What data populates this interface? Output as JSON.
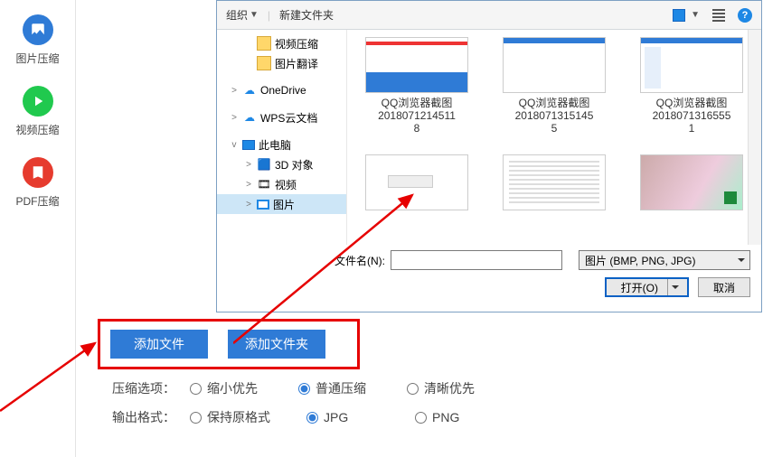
{
  "sidebar": {
    "items": [
      {
        "label": "图片压缩",
        "bg": "#2f7bd6"
      },
      {
        "label": "视频压缩",
        "bg": "#20c94e"
      },
      {
        "label": "PDF压缩",
        "bg": "#e63b2e"
      }
    ]
  },
  "dialog": {
    "toolbar": {
      "organize": "组织",
      "new_folder": "新建文件夹",
      "help_glyph": "?"
    },
    "tree": {
      "items": [
        {
          "depth": 2,
          "icon": "folder",
          "label": "视频压缩"
        },
        {
          "depth": 2,
          "icon": "folder",
          "label": "图片翻译"
        },
        {
          "depth": 1,
          "icon": "cloud",
          "label": "OneDrive",
          "exp": ">"
        },
        {
          "depth": 1,
          "icon": "cloud",
          "label": "WPS云文档",
          "exp": ">"
        },
        {
          "depth": 1,
          "icon": "pc",
          "label": "此电脑",
          "exp": "v"
        },
        {
          "depth": 2,
          "icon": "obj",
          "label": "3D 对象",
          "exp": ">"
        },
        {
          "depth": 2,
          "icon": "obj",
          "label": "视频",
          "exp": ">"
        },
        {
          "depth": 2,
          "icon": "picf",
          "label": "图片",
          "exp": ">",
          "selected": true
        }
      ]
    },
    "thumbs_row1": [
      {
        "caption_l1": "QQ浏览器截图",
        "caption_l2": "2018071214511",
        "caption_l3": "8"
      },
      {
        "caption_l1": "QQ浏览器截图",
        "caption_l2": "2018071315145",
        "caption_l3": "5"
      },
      {
        "caption_l1": "QQ浏览器截图",
        "caption_l2": "2018071316555",
        "caption_l3": "1"
      }
    ],
    "filename_label": "文件名(N):",
    "filename_value": "",
    "filter_label": "图片 (BMP, PNG, JPG)",
    "open_btn": "打开(O)",
    "cancel_btn": "取消"
  },
  "buttons": {
    "add_file": "添加文件",
    "add_folder": "添加文件夹"
  },
  "options": {
    "row1_label": "压缩选项：",
    "row1_opts": [
      "缩小优先",
      "普通压缩",
      "清晰优先"
    ],
    "row1_selected": 1,
    "row2_label": "输出格式：",
    "row2_opts": [
      "保持原格式",
      "JPG",
      "PNG"
    ],
    "row2_selected": 1
  }
}
